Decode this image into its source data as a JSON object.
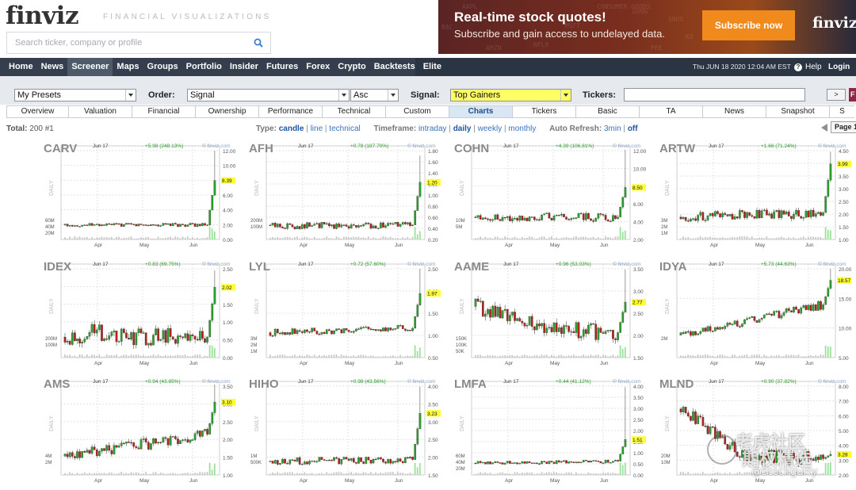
{
  "header": {
    "logo": "finviz",
    "tagline": "FINANCIAL VISUALIZATIONS",
    "search_placeholder": "Search ticker, company or profile",
    "search_icon": "search-icon"
  },
  "banner": {
    "title": "Real-time stock quotes!",
    "subtitle": "Subscribe and gain access to undelayed data.",
    "button": "Subscribe now",
    "logo": "finviz",
    "background_tickers": [
      "AAPL",
      "NFLX",
      "CONSUMER GOODS",
      "PFE",
      "SBUX",
      "KO",
      "MSFT",
      "AMZN",
      "GOOG",
      "BAC"
    ]
  },
  "nav": {
    "items": [
      "Home",
      "News",
      "Screener",
      "Maps",
      "Groups",
      "Portfolio",
      "Insider",
      "Futures",
      "Forex",
      "Crypto",
      "Backtests",
      "Elite"
    ],
    "active": "Screener",
    "datetime": "Thu JUN 18 2020 12:04 AM EST",
    "help": "Help",
    "login": "Login"
  },
  "filters": {
    "presets": "My Presets",
    "order_label": "Order:",
    "order_value": "Signal",
    "order_dir": "Asc",
    "signal_label": "Signal:",
    "signal_value": "Top Gainers",
    "tickers_label": "Tickers:",
    "tickers_value": "",
    "go": ">",
    "edge": "F"
  },
  "tabs": [
    "Overview",
    "Valuation",
    "Financial",
    "Ownership",
    "Performance",
    "Technical",
    "Custom",
    "Charts",
    "Tickers",
    "Basic",
    "TA",
    "News",
    "Snapshot",
    "S"
  ],
  "active_tab": "Charts",
  "subbar": {
    "total_label": "Total:",
    "total_value": "200",
    "page_label": "#1",
    "type_label": "Type:",
    "type_options": [
      "candle",
      "line",
      "technical"
    ],
    "timeframe_label": "Timeframe:",
    "timeframe_options": [
      "intraday",
      "daily",
      "weekly",
      "monthly"
    ],
    "refresh_label": "Auto Refresh:",
    "refresh_options": [
      "3min",
      "off"
    ],
    "page_select": "Page 1"
  },
  "chart_common": {
    "date": "Jun 17",
    "source": "finviz.com",
    "period": "DAILY",
    "months": [
      "Apr",
      "May",
      "Jun"
    ],
    "up_color": "#2ca02c",
    "down_color": "#b22222",
    "last_price_bg": "#ffff33"
  },
  "chart_data": [
    {
      "type": "candlestick",
      "ticker": "CARV",
      "change": "+5.98 (248.13%)",
      "last": "8.39",
      "yticks": [
        "12.00",
        "10.00",
        "8.00",
        "6.00",
        "4.00",
        "2.00",
        "0.00"
      ],
      "volticks": [
        "60M",
        "40M",
        "20M"
      ],
      "ylim": [
        0,
        13
      ]
    },
    {
      "type": "candlestick",
      "ticker": "AFH",
      "change": "+0.78 (187.70%)",
      "last": "1.20",
      "yticks": [
        "1.80",
        "1.60",
        "1.40",
        "1.20",
        "1.00",
        "0.80",
        "0.60",
        "0.40",
        "0.20"
      ],
      "volticks": [
        "200M",
        "100M"
      ],
      "ylim": [
        0.2,
        1.9
      ]
    },
    {
      "type": "candlestick",
      "ticker": "COHN",
      "change": "+4.39 (106.81%)",
      "last": "8.50",
      "yticks": [
        "12.00",
        "10.00",
        "8.00",
        "6.00",
        "4.00",
        "2.00"
      ],
      "volticks": [
        "10M",
        "5M"
      ],
      "ylim": [
        2,
        13
      ]
    },
    {
      "type": "candlestick",
      "ticker": "ARTW",
      "change": "+1.66 (71.24%)",
      "last": "3.99",
      "yticks": [
        "4.50",
        "4.00",
        "3.50",
        "3.00",
        "2.50",
        "2.00",
        "1.50",
        "1.00"
      ],
      "volticks": [
        "3M",
        "2M",
        "1M"
      ],
      "ylim": [
        1,
        4.6
      ]
    },
    {
      "type": "candlestick",
      "ticker": "IDEX",
      "change": "+0.83 (69.75%)",
      "last": "2.02",
      "yticks": [
        "2.50",
        "2.00",
        "1.50",
        "1.00",
        "0.50",
        "0.00"
      ],
      "volticks": [
        "200M",
        "100M"
      ],
      "ylim": [
        0,
        2.6
      ]
    },
    {
      "type": "candlestick",
      "ticker": "LYL",
      "change": "+0.72 (57.60%)",
      "last": "1.97",
      "yticks": [
        "2.50",
        "2.00",
        "1.50",
        "1.00",
        "0.50"
      ],
      "volticks": [
        "3M",
        "2M",
        "1M"
      ],
      "ylim": [
        0.5,
        2.6
      ]
    },
    {
      "type": "candlestick",
      "ticker": "AAME",
      "change": "+0.96 (53.03%)",
      "last": "2.77",
      "yticks": [
        "3.50",
        "3.00",
        "2.50",
        "2.00",
        "1.50"
      ],
      "volticks": [
        "150K",
        "100K",
        "50K"
      ],
      "ylim": [
        1.5,
        3.6
      ]
    },
    {
      "type": "candlestick",
      "ticker": "IDYA",
      "change": "+5.73 (44.63%)",
      "last": "18.57",
      "yticks": [
        "20.00",
        "15.00",
        "10.00",
        "5.00"
      ],
      "volticks": [
        "2M"
      ],
      "ylim": [
        0,
        21
      ]
    },
    {
      "type": "candlestick",
      "ticker": "AMS",
      "change": "+0.94 (43.85%)",
      "last": "3.10",
      "yticks": [
        "3.50",
        "3.00",
        "2.50",
        "2.00",
        "1.50",
        "1.00"
      ],
      "volticks": [
        "4M",
        "2M"
      ],
      "ylim": [
        1,
        3.6
      ]
    },
    {
      "type": "candlestick",
      "ticker": "HIHO",
      "change": "+0.98 (43.56%)",
      "last": "3.23",
      "yticks": [
        "4.00",
        "3.50",
        "3.00",
        "2.50",
        "2.00",
        "1.50"
      ],
      "volticks": [
        "1M",
        "500K"
      ],
      "ylim": [
        1.5,
        4.1
      ]
    },
    {
      "type": "candlestick",
      "ticker": "LMFA",
      "change": "+0.44 (41.12%)",
      "last": "1.51",
      "yticks": [
        "4.00",
        "3.50",
        "3.00",
        "2.50",
        "2.00",
        "1.50",
        "1.00",
        "0.50",
        "0.00"
      ],
      "volticks": [
        "60M",
        "40M",
        "20M"
      ],
      "ylim": [
        0,
        4.1
      ]
    },
    {
      "type": "candlestick",
      "ticker": "MLND",
      "change": "+0.90 (37.82%)",
      "last": "3.28",
      "yticks": [
        "8.00",
        "7.00",
        "6.00",
        "5.00",
        "4.00",
        "3.00",
        "2.00"
      ],
      "volticks": [
        "20M",
        "10M"
      ],
      "ylim": [
        2,
        8.3
      ]
    }
  ],
  "watermark": {
    "line1": "老虎社区",
    "line2": "期权精选",
    "line3": "@Stockgurry"
  }
}
